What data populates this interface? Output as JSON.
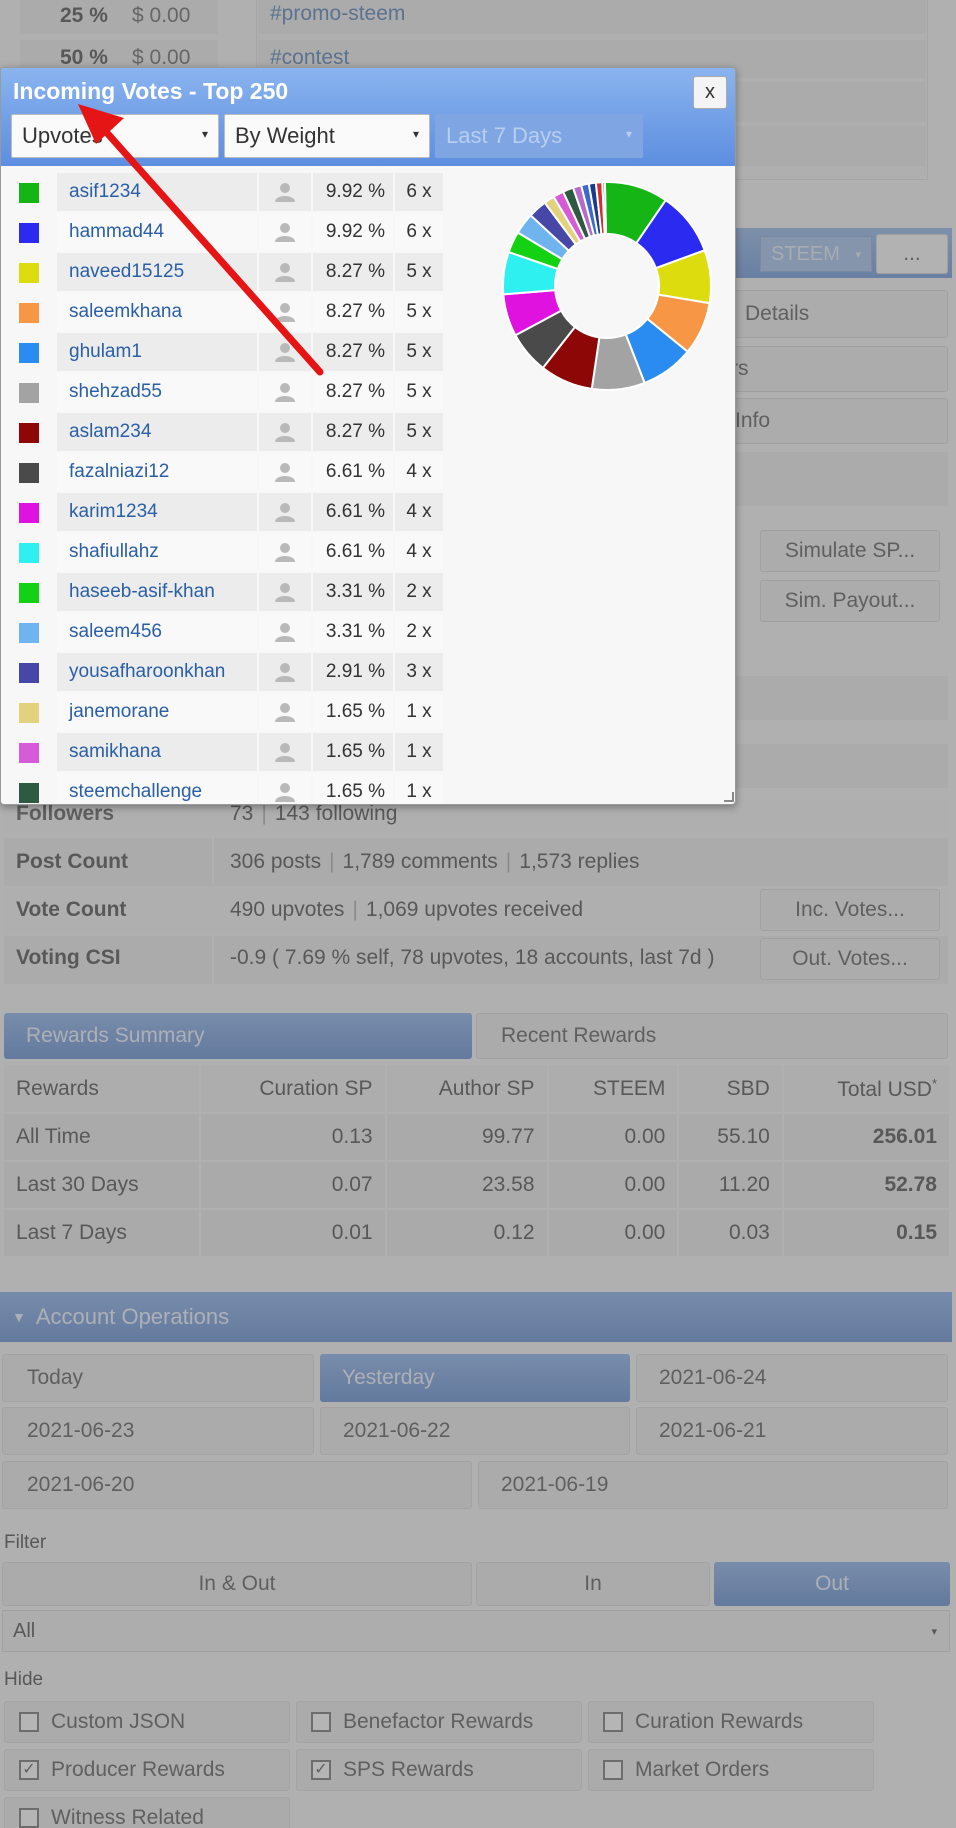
{
  "top_rows": [
    {
      "pct": "25 %",
      "amount": "$ 0.00"
    },
    {
      "pct": "50 %",
      "amount": "$ 0.00"
    }
  ],
  "tags": [
    "#promo-steem",
    "#contest"
  ],
  "right_panel": {
    "currency": "STEEM",
    "more": "...",
    "items": [
      "Details",
      "rs",
      "Info"
    ],
    "simulate_sp": "Simulate SP...",
    "sim_payout": "Sim. Payout..."
  },
  "stats": {
    "followers": {
      "label": "Followers",
      "count": "73",
      "following": "143 following"
    },
    "post_count": {
      "label": "Post Count",
      "posts": "306 posts",
      "comments": "1,789 comments",
      "replies": "1,573 replies"
    },
    "vote_count": {
      "label": "Vote Count",
      "upvotes": "490 upvotes",
      "received": "1,069 upvotes received",
      "button": "Inc. Votes..."
    },
    "voting_csi": {
      "label": "Voting CSI",
      "value": "-0.9 ( 7.69 % self, 78 upvotes, 18 accounts, last 7d )",
      "button": "Out. Votes..."
    }
  },
  "rewards": {
    "tabs": [
      "Rewards Summary",
      "Recent Rewards"
    ],
    "headers": [
      "Rewards",
      "Curation SP",
      "Author SP",
      "STEEM",
      "SBD",
      "Total USD"
    ],
    "total_usd_mark": "*",
    "rows": [
      {
        "label": "All Time",
        "curation": "0.13",
        "author": "99.77",
        "steem": "0.00",
        "sbd": "55.10",
        "total": "256.01"
      },
      {
        "label": "Last 30 Days",
        "curation": "0.07",
        "author": "23.58",
        "steem": "0.00",
        "sbd": "11.20",
        "total": "52.78"
      },
      {
        "label": "Last 7 Days",
        "curation": "0.01",
        "author": "0.12",
        "steem": "0.00",
        "sbd": "0.03",
        "total": "0.15"
      }
    ]
  },
  "operations": {
    "title": "Account Operations",
    "dates_row1": [
      "Today",
      "Yesterday",
      "2021-06-24"
    ],
    "dates_row2": [
      "2021-06-23",
      "2021-06-22",
      "2021-06-21"
    ],
    "dates_row3": [
      "2021-06-20",
      "2021-06-19"
    ],
    "filter_label": "Filter",
    "filter_tabs": [
      "In & Out",
      "In",
      "Out"
    ],
    "filter_select": "All",
    "hide_label": "Hide",
    "hide_options": [
      {
        "label": "Custom JSON",
        "checked": false
      },
      {
        "label": "Benefactor Rewards",
        "checked": false
      },
      {
        "label": "Curation Rewards",
        "checked": false
      },
      {
        "label": "Producer Rewards",
        "checked": true
      },
      {
        "label": "SPS Rewards",
        "checked": true
      },
      {
        "label": "Market Orders",
        "checked": false
      },
      {
        "label": "Witness Related",
        "checked": false
      }
    ]
  },
  "popup": {
    "title": "Incoming Votes - Top 250",
    "close": "x",
    "select_type": "Upvotes",
    "select_order": "By Weight",
    "select_period": "Last 7 Days",
    "voters": [
      {
        "name": "asif1234",
        "pct": "9.92 %",
        "count": "6 x",
        "color": "#14b514"
      },
      {
        "name": "hammad44",
        "pct": "9.92 %",
        "count": "6 x",
        "color": "#2a2af0"
      },
      {
        "name": "naveed15125",
        "pct": "8.27 %",
        "count": "5 x",
        "color": "#dcdc0e"
      },
      {
        "name": "saleemkhana",
        "pct": "8.27 %",
        "count": "5 x",
        "color": "#f79644"
      },
      {
        "name": "ghulam1",
        "pct": "8.27 %",
        "count": "5 x",
        "color": "#2a8cf0"
      },
      {
        "name": "shehzad55",
        "pct": "8.27 %",
        "count": "5 x",
        "color": "#a3a3a3"
      },
      {
        "name": "aslam234",
        "pct": "8.27 %",
        "count": "5 x",
        "color": "#8e0707"
      },
      {
        "name": "fazalniazi12",
        "pct": "6.61 %",
        "count": "4 x",
        "color": "#4a4a4a"
      },
      {
        "name": "karim1234",
        "pct": "6.61 %",
        "count": "4 x",
        "color": "#e012e0"
      },
      {
        "name": "shafiullahz",
        "pct": "6.61 %",
        "count": "4 x",
        "color": "#2ef0f0"
      },
      {
        "name": "haseeb-asif-khan",
        "pct": "3.31 %",
        "count": "2 x",
        "color": "#14d114"
      },
      {
        "name": "saleem456",
        "pct": "3.31 %",
        "count": "2 x",
        "color": "#6fb4ef"
      },
      {
        "name": "yousafharoonkhan",
        "pct": "2.91 %",
        "count": "3 x",
        "color": "#4747a8"
      },
      {
        "name": "janemorane",
        "pct": "1.65 %",
        "count": "1 x",
        "color": "#e3d27d"
      },
      {
        "name": "samikhana",
        "pct": "1.65 %",
        "count": "1 x",
        "color": "#d65bd6"
      },
      {
        "name": "steemchallenge",
        "pct": "1.65 %",
        "count": "1 x",
        "color": "#2d5a40"
      }
    ],
    "donut_extra": [
      {
        "value": 1.3,
        "color": "#b56bc9"
      },
      {
        "value": 1.2,
        "color": "#3a6ad1"
      },
      {
        "value": 1.1,
        "color": "#1a3a8a"
      },
      {
        "value": 1.0,
        "color": "#d03030"
      },
      {
        "value": 0.4,
        "color": "#7a7a7a"
      }
    ]
  },
  "annotation": {
    "arrow_color": "#e51515"
  }
}
